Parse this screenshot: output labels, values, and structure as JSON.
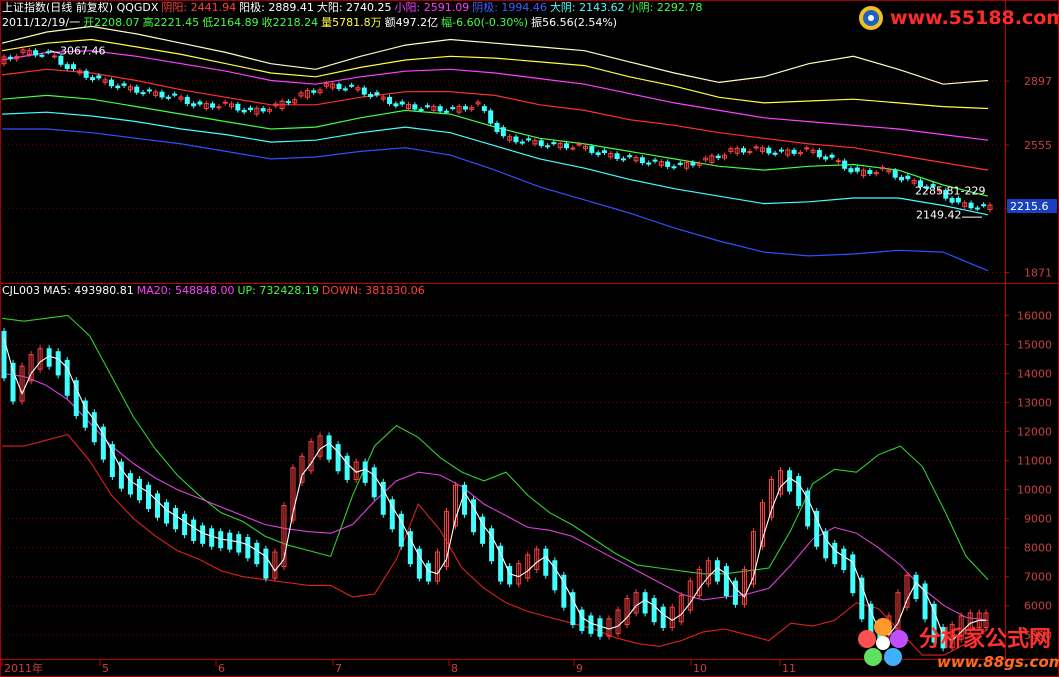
{
  "header": {
    "row1": [
      {
        "text": "上证指数(日线 前复权) QQGDX",
        "color": "#ffffff"
      },
      {
        "text": "阴阳: 2441.94",
        "color": "#ff4040"
      },
      {
        "text": "阳极: 2889.41",
        "color": "#ffffff"
      },
      {
        "text": "大阳: 2740.25",
        "color": "#ffffff"
      },
      {
        "text": "小阳: 2591.09",
        "color": "#ff40ff"
      },
      {
        "text": "阴极: 1994.46",
        "color": "#4060ff"
      },
      {
        "text": "大阴: 2143.62",
        "color": "#40ffff"
      },
      {
        "text": "小阴: 2292.78",
        "color": "#40ff40"
      }
    ],
    "row2": [
      {
        "text": "2011/12/19/一",
        "color": "#ffffff"
      },
      {
        "text": "开2208.07",
        "color": "#40ff40"
      },
      {
        "text": "高2221.45",
        "color": "#40ff40"
      },
      {
        "text": "低2164.89",
        "color": "#40ff40"
      },
      {
        "text": "收2218.24",
        "color": "#40ff40"
      },
      {
        "text": "量5781.8万",
        "color": "#ffff40"
      },
      {
        "text": "额497.2亿",
        "color": "#ffffff"
      },
      {
        "text": "幅-6.60(-0.30%)",
        "color": "#40ff40"
      },
      {
        "text": "振56.56(2.54%)",
        "color": "#ffffff"
      }
    ],
    "row3": [
      {
        "text": "CJL003",
        "color": "#ffffff"
      },
      {
        "text": "MA5: 493980.81",
        "color": "#ffffff"
      },
      {
        "text": "MA20: 548848.00",
        "color": "#ff40ff"
      },
      {
        "text": "UP: 732428.19",
        "color": "#40ff40"
      },
      {
        "text": "DOWN: 381830.06",
        "color": "#ff4040"
      }
    ]
  },
  "watermark_top": "www.55188.com",
  "watermark_bottom_cn": "分析家公式网",
  "watermark_bottom_url": "www.88gs.com",
  "chart_data": [
    {
      "type": "candlestick",
      "title": "上证指数(日线 前复权)",
      "x_months": [
        "2011年",
        "5",
        "6",
        "7",
        "8",
        "9",
        "10",
        "11"
      ],
      "yticks": [
        2897,
        2555,
        2215,
        1871
      ],
      "ylim": [
        1820,
        3160
      ],
      "current_price_label": "2215.6",
      "annotations": {
        "high_label": "3067.46",
        "low_label": "2149.42",
        "right_label": "2285.81-229"
      },
      "close_points": [
        [
          0,
          3000
        ],
        [
          10,
          3050
        ],
        [
          20,
          3040
        ],
        [
          30,
          2950
        ],
        [
          40,
          2900
        ],
        [
          50,
          2860
        ],
        [
          60,
          2830
        ],
        [
          70,
          2810
        ],
        [
          80,
          2760
        ],
        [
          90,
          2770
        ],
        [
          100,
          2730
        ],
        [
          110,
          2760
        ],
        [
          120,
          2820
        ],
        [
          130,
          2870
        ],
        [
          140,
          2860
        ],
        [
          150,
          2810
        ],
        [
          160,
          2760
        ],
        [
          170,
          2750
        ],
        [
          180,
          2740
        ],
        [
          190,
          2770
        ],
        [
          200,
          2590
        ],
        [
          210,
          2570
        ],
        [
          220,
          2550
        ],
        [
          230,
          2545
        ],
        [
          240,
          2500
        ],
        [
          250,
          2480
        ],
        [
          260,
          2455
        ],
        [
          270,
          2440
        ],
        [
          280,
          2470
        ],
        [
          290,
          2520
        ],
        [
          300,
          2530
        ],
        [
          310,
          2510
        ],
        [
          320,
          2525
        ],
        [
          330,
          2475
        ],
        [
          340,
          2400
        ],
        [
          350,
          2420
        ],
        [
          360,
          2360
        ],
        [
          370,
          2320
        ],
        [
          380,
          2235
        ],
        [
          390,
          2218
        ]
      ],
      "bands": [
        {
          "name": "阳极",
          "color": "#ffffc0",
          "values": [
            3100,
            3160,
            3190,
            3150,
            3100,
            3050,
            2990,
            2960,
            3030,
            3090,
            3120,
            3100,
            3080,
            3060,
            3000,
            2940,
            2890,
            2920,
            2990,
            3030,
            2960,
            2880,
            2900
          ]
        },
        {
          "name": "大阳",
          "color": "#ffff40",
          "values": [
            3060,
            3100,
            3120,
            3080,
            3040,
            2990,
            2940,
            2920,
            2970,
            3010,
            3030,
            3020,
            3000,
            2980,
            2920,
            2870,
            2810,
            2780,
            2790,
            2800,
            2780,
            2760,
            2750
          ]
        },
        {
          "name": "小阳",
          "color": "#ff40ff",
          "values": [
            3010,
            3050,
            3060,
            3030,
            2990,
            2950,
            2900,
            2880,
            2920,
            2950,
            2960,
            2940,
            2910,
            2880,
            2830,
            2780,
            2740,
            2700,
            2680,
            2660,
            2640,
            2610,
            2580
          ]
        },
        {
          "name": "阴阳",
          "color": "#ff3030",
          "values": [
            2930,
            2960,
            2940,
            2900,
            2850,
            2810,
            2770,
            2770,
            2810,
            2840,
            2840,
            2820,
            2770,
            2740,
            2690,
            2660,
            2620,
            2590,
            2560,
            2540,
            2500,
            2460,
            2420
          ]
        },
        {
          "name": "小阴",
          "color": "#40ff40",
          "values": [
            2800,
            2820,
            2800,
            2760,
            2720,
            2680,
            2640,
            2650,
            2700,
            2740,
            2720,
            2650,
            2590,
            2560,
            2520,
            2480,
            2440,
            2420,
            2440,
            2450,
            2420,
            2340,
            2280
          ]
        },
        {
          "name": "大阴",
          "color": "#40ffff",
          "values": [
            2720,
            2730,
            2710,
            2680,
            2640,
            2610,
            2570,
            2580,
            2620,
            2650,
            2620,
            2550,
            2480,
            2430,
            2370,
            2320,
            2280,
            2240,
            2250,
            2270,
            2270,
            2230,
            2180
          ]
        },
        {
          "name": "阴极",
          "color": "#3050ff",
          "values": [
            2640,
            2640,
            2620,
            2590,
            2560,
            2520,
            2480,
            2490,
            2520,
            2540,
            2500,
            2420,
            2330,
            2260,
            2190,
            2110,
            2040,
            1980,
            1960,
            1970,
            1990,
            1980,
            1880
          ]
        }
      ]
    },
    {
      "type": "bar",
      "title": "CJL003",
      "yticks": [
        16000,
        15000,
        14000,
        13000,
        12000,
        11000,
        10000,
        9000,
        8000,
        7000,
        6000,
        5000
      ],
      "ylim": [
        4200,
        16600
      ],
      "volume_points": [
        [
          0,
          15200
        ],
        [
          4,
          14100
        ],
        [
          8,
          13300
        ],
        [
          12,
          14000
        ],
        [
          16,
          14400
        ],
        [
          20,
          14600
        ],
        [
          24,
          14500
        ],
        [
          28,
          14200
        ],
        [
          32,
          13500
        ],
        [
          36,
          12800
        ],
        [
          40,
          12400
        ],
        [
          44,
          11900
        ],
        [
          48,
          11300
        ],
        [
          52,
          10700
        ],
        [
          56,
          10300
        ],
        [
          60,
          10100
        ],
        [
          64,
          9900
        ],
        [
          68,
          9600
        ],
        [
          72,
          9300
        ],
        [
          76,
          9100
        ],
        [
          80,
          8900
        ],
        [
          84,
          8700
        ],
        [
          88,
          8500
        ],
        [
          92,
          8400
        ],
        [
          96,
          8300
        ],
        [
          100,
          8250
        ],
        [
          104,
          8200
        ],
        [
          108,
          8100
        ],
        [
          112,
          7900
        ],
        [
          116,
          7700
        ],
        [
          120,
          7200
        ],
        [
          124,
          7600
        ],
        [
          128,
          9200
        ],
        [
          132,
          10500
        ],
        [
          136,
          10900
        ],
        [
          140,
          11400
        ],
        [
          144,
          11600
        ],
        [
          148,
          11300
        ],
        [
          152,
          10900
        ],
        [
          156,
          10600
        ],
        [
          160,
          10700
        ],
        [
          164,
          10500
        ],
        [
          168,
          10000
        ],
        [
          172,
          9400
        ],
        [
          176,
          8900
        ],
        [
          180,
          8300
        ],
        [
          184,
          7700
        ],
        [
          188,
          7200
        ],
        [
          192,
          7100
        ],
        [
          196,
          7600
        ],
        [
          200,
          9000
        ],
        [
          204,
          9900
        ],
        [
          208,
          9400
        ],
        [
          212,
          8800
        ],
        [
          216,
          8400
        ],
        [
          220,
          7800
        ],
        [
          224,
          7100
        ],
        [
          228,
          7000
        ],
        [
          232,
          7200
        ],
        [
          236,
          7500
        ],
        [
          240,
          7700
        ],
        [
          244,
          7300
        ],
        [
          248,
          6800
        ],
        [
          252,
          6200
        ],
        [
          256,
          5600
        ],
        [
          260,
          5400
        ],
        [
          264,
          5300
        ],
        [
          268,
          5200
        ],
        [
          272,
          5300
        ],
        [
          276,
          5600
        ],
        [
          280,
          6000
        ],
        [
          284,
          6200
        ],
        [
          288,
          6000
        ],
        [
          292,
          5700
        ],
        [
          296,
          5500
        ],
        [
          300,
          5700
        ],
        [
          304,
          6100
        ],
        [
          308,
          6600
        ],
        [
          312,
          7000
        ],
        [
          316,
          7300
        ],
        [
          320,
          7100
        ],
        [
          324,
          6600
        ],
        [
          328,
          6300
        ],
        [
          332,
          7000
        ],
        [
          336,
          8300
        ],
        [
          340,
          9300
        ],
        [
          344,
          10100
        ],
        [
          348,
          10400
        ],
        [
          352,
          10200
        ],
        [
          356,
          9700
        ],
        [
          360,
          9000
        ],
        [
          364,
          8300
        ],
        [
          368,
          7900
        ],
        [
          372,
          7700
        ],
        [
          376,
          7500
        ],
        [
          380,
          6700
        ],
        [
          384,
          5800
        ],
        [
          388,
          5100
        ],
        [
          392,
          5000
        ],
        [
          396,
          5400
        ],
        [
          400,
          6200
        ],
        [
          404,
          6800
        ],
        [
          408,
          6500
        ],
        [
          412,
          5800
        ],
        [
          416,
          5000
        ],
        [
          420,
          4800
        ],
        [
          424,
          5100
        ],
        [
          428,
          5400
        ],
        [
          432,
          5500
        ],
        [
          435,
          5500
        ]
      ],
      "ma20": [
        14000,
        13900,
        13600,
        13100,
        12300,
        11500,
        10900,
        10400,
        10000,
        9700,
        9400,
        9100,
        8800,
        8650,
        8550,
        8500,
        8800,
        9600,
        10300,
        10600,
        10500,
        10100,
        9500,
        9100,
        8700,
        8600,
        8400,
        8000,
        7600,
        7200,
        6800,
        6400,
        6200,
        6300,
        6400,
        6600,
        7400,
        8300,
        8700,
        8500,
        8000,
        7400,
        6600,
        6000,
        5600,
        5500
      ],
      "up": [
        15900,
        15800,
        15900,
        16000,
        15300,
        13900,
        12500,
        11400,
        10500,
        9800,
        9200,
        8900,
        8400,
        8100,
        7900,
        7700,
        9800,
        11500,
        12200,
        11800,
        11100,
        10600,
        10300,
        10600,
        9800,
        9200,
        8800,
        8300,
        7800,
        7400,
        7300,
        7200,
        7100,
        7100,
        7200,
        7300,
        8600,
        10200,
        10700,
        10600,
        11200,
        11500,
        10800,
        9300,
        7700,
        6900
      ],
      "down": [
        11500,
        11500,
        11700,
        11900,
        11000,
        9800,
        9000,
        8400,
        7900,
        7600,
        7200,
        7000,
        6900,
        6800,
        6700,
        6700,
        6300,
        6400,
        7600,
        9500,
        8600,
        7300,
        6600,
        6100,
        5800,
        5600,
        5400,
        5200,
        4900,
        4700,
        4600,
        4800,
        5100,
        5200,
        5000,
        4800,
        5400,
        5300,
        5500,
        6100,
        5900,
        5100,
        4300,
        4300,
        4700,
        5200
      ]
    }
  ]
}
